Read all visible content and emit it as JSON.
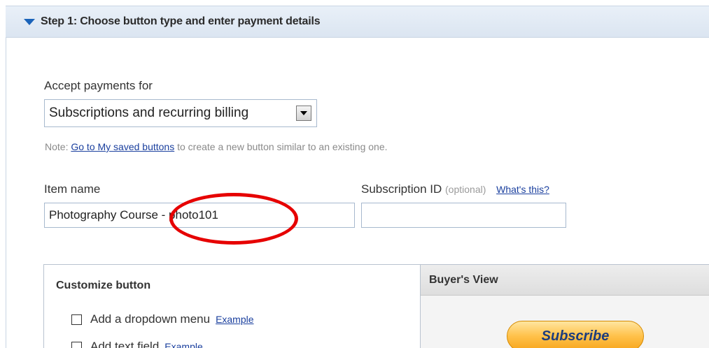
{
  "step": {
    "title": "Step 1: Choose button type and enter payment details"
  },
  "accept_payments": {
    "label": "Accept payments for",
    "selected": "Subscriptions and recurring billing"
  },
  "note": {
    "prefix": "Note:",
    "link": "Go to My saved buttons",
    "suffix": "to create a new button similar to an existing one."
  },
  "item_name": {
    "label": "Item name",
    "value": "Photography Course - photo101"
  },
  "subscription_id": {
    "label": "Subscription ID",
    "optional": "(optional)",
    "help_link": "What's this?",
    "value": ""
  },
  "customize": {
    "title": "Customize button",
    "options": [
      {
        "label": "Add a dropdown menu",
        "example": "Example"
      },
      {
        "label": "Add text field",
        "example": "Example"
      }
    ]
  },
  "buyers_view": {
    "title": "Buyer's View",
    "button_label": "Subscribe"
  },
  "colors": {
    "link": "#1a3f9e",
    "highlight_circle": "#e60000",
    "subscribe_button": "#ffc14a"
  }
}
